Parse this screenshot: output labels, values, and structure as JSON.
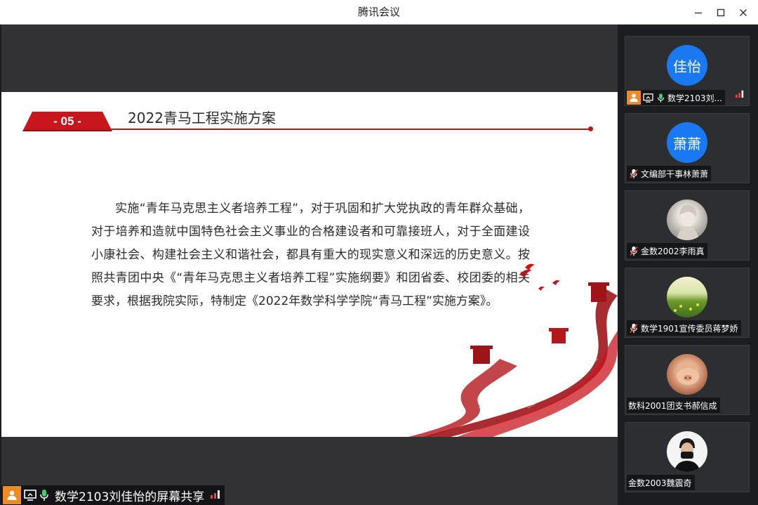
{
  "window": {
    "title": "腾讯会议"
  },
  "slide": {
    "badge": "- 05 -",
    "title": "2022青马工程实施方案",
    "body": "实施“青年马克思主义者培养工程”，对于巩固和扩大党执政的青年群众基础，对于培养和造就中国特色社会主义事业的合格建设者和可靠接班人，对于全面建设小康社会、构建社会主义和谐社会，都具有重大的现实意义和深远的历史意义。按照共青团中央《“青年马克思主义者培养工程”实施纲要》和团省委、校团委的相关要求，根据我院实际，特制定《2022年数学科学学院“青马工程”实施方案》。"
  },
  "presenter": {
    "label": "数学2103刘佳怡的屏幕共享"
  },
  "participants": [
    {
      "name": "数学2103刘...",
      "avatar_text": "佳怡",
      "avatar_type": "text",
      "mic": "on",
      "sharing": true
    },
    {
      "name": "文编部干事林萧萧",
      "avatar_text": "萧萧",
      "avatar_type": "text",
      "mic": "muted"
    },
    {
      "name": "金数2002李雨真",
      "avatar_type": "photo-portrait",
      "mic": "muted"
    },
    {
      "name": "数学1901宣传委员蒋梦娇",
      "avatar_type": "photo-field",
      "mic": "muted"
    },
    {
      "name": "数科2001团支书郝信成",
      "avatar_type": "photo-pig",
      "mic": "none"
    },
    {
      "name": "金数2003魏震奇",
      "avatar_type": "photo-person",
      "mic": "none"
    }
  ],
  "colors": {
    "accent_red": "#b8181b",
    "avatar_blue": "#1a79f0",
    "share_orange": "#f08a24",
    "mic_green": "#3bd16f",
    "signal_red": "#e8443a"
  }
}
